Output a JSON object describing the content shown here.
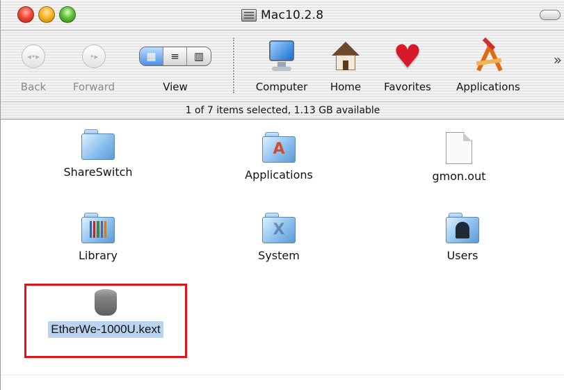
{
  "window": {
    "title": "Mac10.2.8"
  },
  "toolbar": {
    "back_label": "Back",
    "forward_label": "Forward",
    "view_label": "View",
    "computer_label": "Computer",
    "home_label": "Home",
    "favorites_label": "Favorites",
    "applications_label": "Applications",
    "overflow": "»"
  },
  "status": {
    "text": "1 of 7 items selected, 1.13 GB available"
  },
  "items": [
    {
      "name": "ShareSwitch",
      "icon": "folder-icon"
    },
    {
      "name": "Applications",
      "icon": "applications-folder-icon"
    },
    {
      "name": "gmon.out",
      "icon": "document-icon"
    },
    {
      "name": "Library",
      "icon": "library-folder-icon"
    },
    {
      "name": "System",
      "icon": "system-folder-icon"
    },
    {
      "name": "Users",
      "icon": "users-folder-icon"
    },
    {
      "name": "EtherWe-1000U.kext",
      "icon": "kext-icon",
      "selected": true
    }
  ],
  "colors": {
    "selection": "#b9d3f0",
    "highlight_box": "#e2141a"
  }
}
